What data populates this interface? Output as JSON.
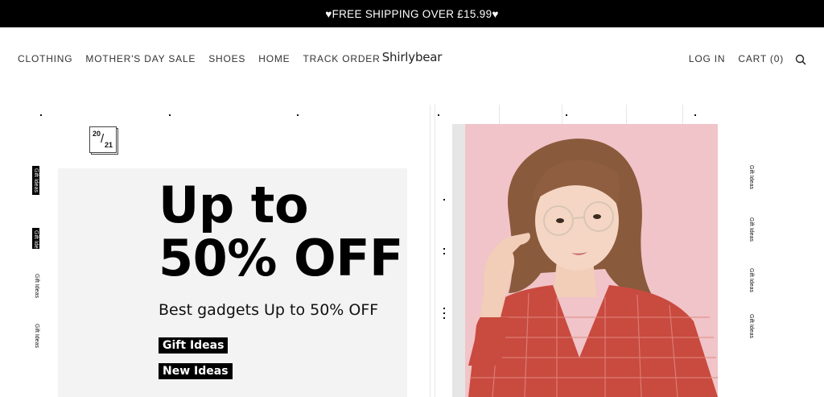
{
  "announcement": {
    "text": "♥FREE SHIPPING OVER £15.99♥"
  },
  "header": {
    "nav_left": [
      "CLOTHING",
      "MOTHER'S DAY SALE",
      "SHOES",
      "HOME",
      "TRACK ORDER"
    ],
    "brand": "Shirlybear",
    "login": "LOG IN",
    "cart": "CART (0)",
    "search_icon": "search-icon"
  },
  "badge": {
    "top": "20",
    "bottom": "21"
  },
  "side_tabs": [
    "Gift Ideas",
    "Gift Ideas",
    "Gift Ideas",
    "Gift Ideas"
  ],
  "right_tabs": [
    "Gift Ideas",
    "Gift Ideas",
    "Gift Ideas",
    "Gift Ideas"
  ],
  "promo": {
    "headline_line1": "Up to",
    "headline_line2": "50% OFF",
    "subline": "Best gadgets Up to 50% OFF",
    "tag1": "Gift Ideas",
    "tag2": "New Ideas"
  },
  "colors": {
    "announcement_bg": "#000000",
    "promo_bg": "#f3f3f3",
    "photo_bg": "#f0c4c8",
    "shirt": "#c94a3f"
  }
}
